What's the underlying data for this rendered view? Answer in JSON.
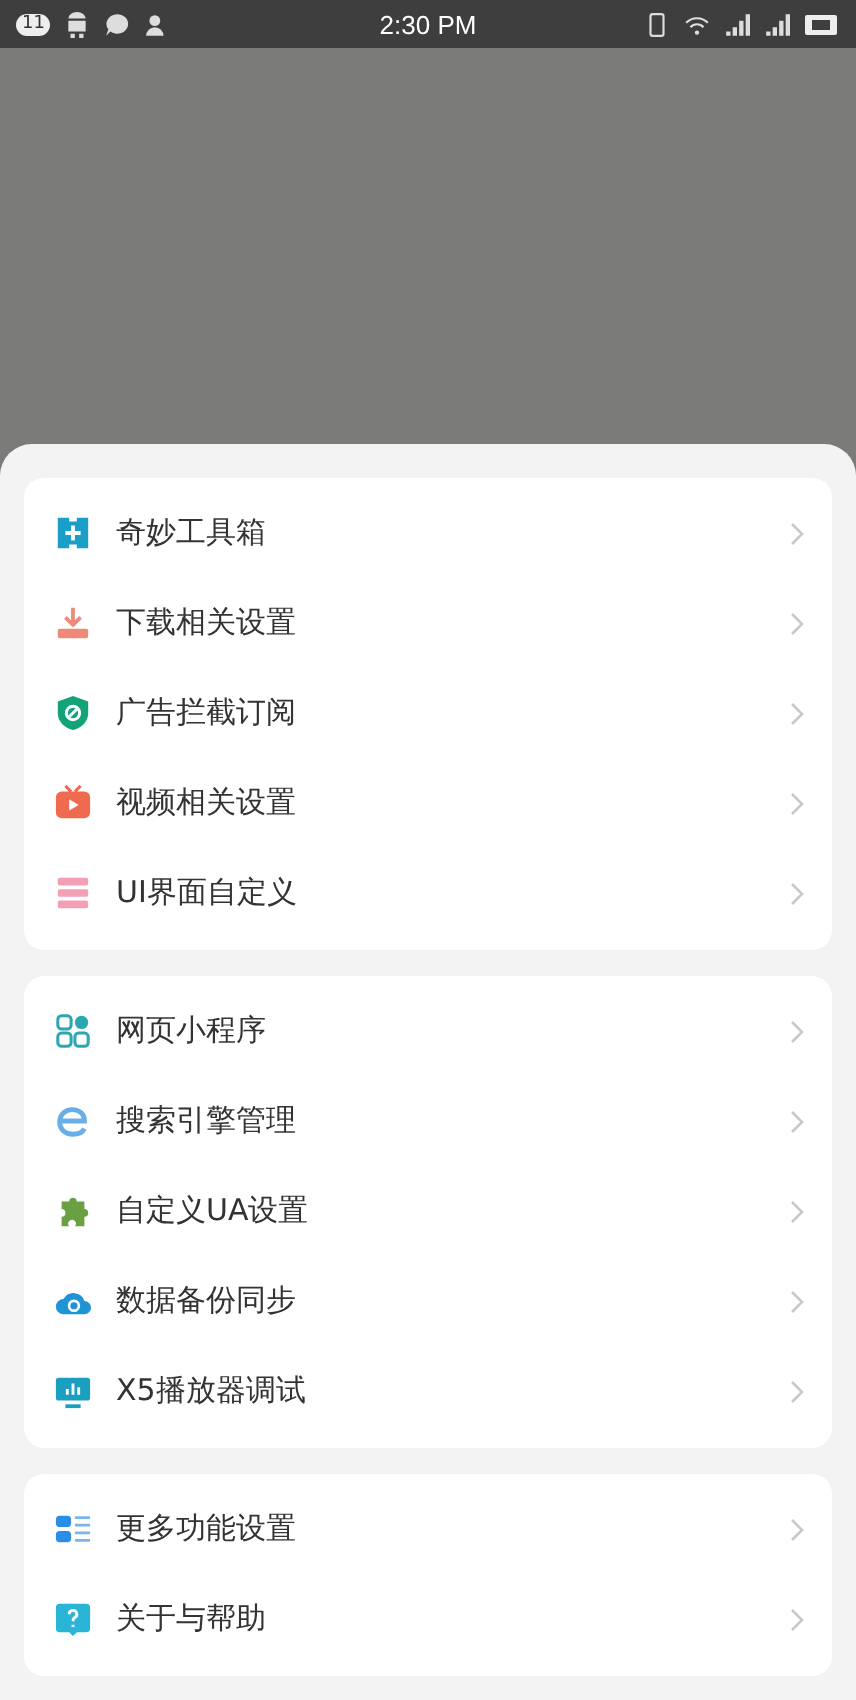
{
  "status_bar": {
    "notification_count": "11",
    "time": "2:30 PM"
  },
  "groups": [
    {
      "items": [
        {
          "kind": "toolbox",
          "label": "奇妙工具箱"
        },
        {
          "kind": "download",
          "label": "下载相关设置"
        },
        {
          "kind": "shield",
          "label": "广告拦截订阅"
        },
        {
          "kind": "video",
          "label": "视频相关设置"
        },
        {
          "kind": "layout",
          "label": "UI界面自定义"
        }
      ]
    },
    {
      "items": [
        {
          "kind": "apps",
          "label": "网页小程序"
        },
        {
          "kind": "browser",
          "label": "搜索引擎管理"
        },
        {
          "kind": "puzzle",
          "label": "自定义UA设置"
        },
        {
          "kind": "cloud",
          "label": "数据备份同步"
        },
        {
          "kind": "monitor",
          "label": "X5播放器调试"
        }
      ]
    },
    {
      "items": [
        {
          "kind": "list",
          "label": "更多功能设置"
        },
        {
          "kind": "help",
          "label": "关于与帮助"
        }
      ]
    }
  ]
}
